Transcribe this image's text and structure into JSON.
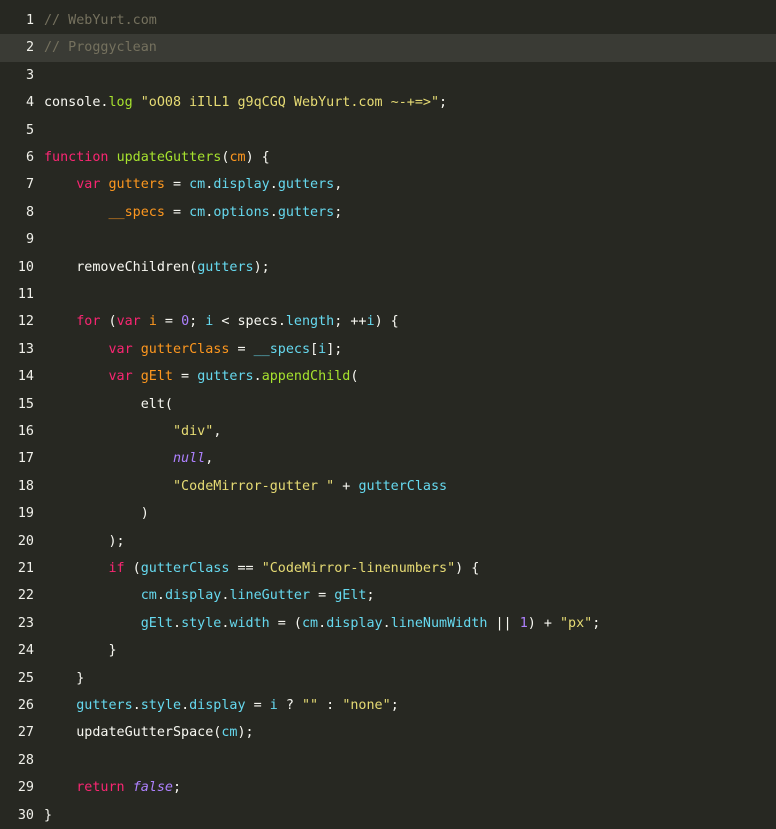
{
  "editor": {
    "active_line": 2,
    "lines": [
      {
        "n": "1",
        "tokens": [
          {
            "t": "// WebYurt.com",
            "c": "comment"
          }
        ]
      },
      {
        "n": "2",
        "tokens": [
          {
            "t": "// Proggyclean",
            "c": "comment"
          }
        ]
      },
      {
        "n": "3",
        "tokens": []
      },
      {
        "n": "4",
        "tokens": [
          {
            "t": "console.",
            "c": "plain"
          },
          {
            "t": "log",
            "c": "prop"
          },
          {
            "t": " ",
            "c": "plain"
          },
          {
            "t": "\"oO08 iIlL1 g9qCGQ WebYurt.com ~-+=>\"",
            "c": "str"
          },
          {
            "t": ";",
            "c": "plain"
          }
        ]
      },
      {
        "n": "5",
        "tokens": []
      },
      {
        "n": "6",
        "tokens": [
          {
            "t": "function",
            "c": "keyword"
          },
          {
            "t": " ",
            "c": "plain"
          },
          {
            "t": "updateGutters",
            "c": "prop"
          },
          {
            "t": "(",
            "c": "plain"
          },
          {
            "t": "cm",
            "c": "def"
          },
          {
            "t": ") {",
            "c": "plain"
          }
        ]
      },
      {
        "n": "7",
        "tokens": [
          {
            "t": "    ",
            "c": "plain"
          },
          {
            "t": "var",
            "c": "keyword"
          },
          {
            "t": " ",
            "c": "plain"
          },
          {
            "t": "gutters",
            "c": "def"
          },
          {
            "t": " = ",
            "c": "plain"
          },
          {
            "t": "cm",
            "c": "var"
          },
          {
            "t": ".",
            "c": "plain"
          },
          {
            "t": "display",
            "c": "var"
          },
          {
            "t": ".",
            "c": "plain"
          },
          {
            "t": "gutters",
            "c": "var"
          },
          {
            "t": ",",
            "c": "plain"
          }
        ]
      },
      {
        "n": "8",
        "tokens": [
          {
            "t": "        ",
            "c": "plain"
          },
          {
            "t": "__specs",
            "c": "def"
          },
          {
            "t": " = ",
            "c": "plain"
          },
          {
            "t": "cm",
            "c": "var"
          },
          {
            "t": ".",
            "c": "plain"
          },
          {
            "t": "options",
            "c": "var"
          },
          {
            "t": ".",
            "c": "plain"
          },
          {
            "t": "gutters",
            "c": "var"
          },
          {
            "t": ";",
            "c": "plain"
          }
        ]
      },
      {
        "n": "9",
        "tokens": []
      },
      {
        "n": "10",
        "tokens": [
          {
            "t": "    removeChildren(",
            "c": "plain"
          },
          {
            "t": "gutters",
            "c": "var"
          },
          {
            "t": ");",
            "c": "plain"
          }
        ]
      },
      {
        "n": "11",
        "tokens": []
      },
      {
        "n": "12",
        "tokens": [
          {
            "t": "    ",
            "c": "plain"
          },
          {
            "t": "for",
            "c": "keyword"
          },
          {
            "t": " (",
            "c": "plain"
          },
          {
            "t": "var",
            "c": "keyword"
          },
          {
            "t": " ",
            "c": "plain"
          },
          {
            "t": "i",
            "c": "def"
          },
          {
            "t": " = ",
            "c": "plain"
          },
          {
            "t": "0",
            "c": "num"
          },
          {
            "t": "; ",
            "c": "plain"
          },
          {
            "t": "i",
            "c": "var"
          },
          {
            "t": " < ",
            "c": "plain"
          },
          {
            "t": "specs",
            "c": "plain"
          },
          {
            "t": ".",
            "c": "plain"
          },
          {
            "t": "length",
            "c": "var"
          },
          {
            "t": "; ++",
            "c": "plain"
          },
          {
            "t": "i",
            "c": "var"
          },
          {
            "t": ") {",
            "c": "plain"
          }
        ]
      },
      {
        "n": "13",
        "tokens": [
          {
            "t": "        ",
            "c": "plain"
          },
          {
            "t": "var",
            "c": "keyword"
          },
          {
            "t": " ",
            "c": "plain"
          },
          {
            "t": "gutterClass",
            "c": "def"
          },
          {
            "t": " = ",
            "c": "plain"
          },
          {
            "t": "__specs",
            "c": "var"
          },
          {
            "t": "[",
            "c": "plain"
          },
          {
            "t": "i",
            "c": "var"
          },
          {
            "t": "];",
            "c": "plain"
          }
        ]
      },
      {
        "n": "14",
        "tokens": [
          {
            "t": "        ",
            "c": "plain"
          },
          {
            "t": "var",
            "c": "keyword"
          },
          {
            "t": " ",
            "c": "plain"
          },
          {
            "t": "gElt",
            "c": "def"
          },
          {
            "t": " = ",
            "c": "plain"
          },
          {
            "t": "gutters",
            "c": "var"
          },
          {
            "t": ".",
            "c": "plain"
          },
          {
            "t": "appendChild",
            "c": "prop"
          },
          {
            "t": "(",
            "c": "plain"
          }
        ]
      },
      {
        "n": "15",
        "tokens": [
          {
            "t": "            elt(",
            "c": "plain"
          }
        ]
      },
      {
        "n": "16",
        "tokens": [
          {
            "t": "                ",
            "c": "plain"
          },
          {
            "t": "\"div\"",
            "c": "str"
          },
          {
            "t": ",",
            "c": "plain"
          }
        ]
      },
      {
        "n": "17",
        "tokens": [
          {
            "t": "                ",
            "c": "plain"
          },
          {
            "t": "null",
            "c": "atom"
          },
          {
            "t": ",",
            "c": "plain"
          }
        ]
      },
      {
        "n": "18",
        "tokens": [
          {
            "t": "                ",
            "c": "plain"
          },
          {
            "t": "\"CodeMirror-gutter \"",
            "c": "str"
          },
          {
            "t": " + ",
            "c": "plain"
          },
          {
            "t": "gutterClass",
            "c": "var"
          }
        ]
      },
      {
        "n": "19",
        "tokens": [
          {
            "t": "            )",
            "c": "plain"
          }
        ]
      },
      {
        "n": "20",
        "tokens": [
          {
            "t": "        );",
            "c": "plain"
          }
        ]
      },
      {
        "n": "21",
        "tokens": [
          {
            "t": "        ",
            "c": "plain"
          },
          {
            "t": "if",
            "c": "keyword"
          },
          {
            "t": " (",
            "c": "plain"
          },
          {
            "t": "gutterClass",
            "c": "var"
          },
          {
            "t": " == ",
            "c": "plain"
          },
          {
            "t": "\"CodeMirror-linenumbers\"",
            "c": "str"
          },
          {
            "t": ") {",
            "c": "plain"
          }
        ]
      },
      {
        "n": "22",
        "tokens": [
          {
            "t": "            ",
            "c": "plain"
          },
          {
            "t": "cm",
            "c": "var"
          },
          {
            "t": ".",
            "c": "plain"
          },
          {
            "t": "display",
            "c": "var"
          },
          {
            "t": ".",
            "c": "plain"
          },
          {
            "t": "lineGutter",
            "c": "var"
          },
          {
            "t": " = ",
            "c": "plain"
          },
          {
            "t": "gElt",
            "c": "var"
          },
          {
            "t": ";",
            "c": "plain"
          }
        ]
      },
      {
        "n": "23",
        "tokens": [
          {
            "t": "            ",
            "c": "plain"
          },
          {
            "t": "gElt",
            "c": "var"
          },
          {
            "t": ".",
            "c": "plain"
          },
          {
            "t": "style",
            "c": "var"
          },
          {
            "t": ".",
            "c": "plain"
          },
          {
            "t": "width",
            "c": "var"
          },
          {
            "t": " = (",
            "c": "plain"
          },
          {
            "t": "cm",
            "c": "var"
          },
          {
            "t": ".",
            "c": "plain"
          },
          {
            "t": "display",
            "c": "var"
          },
          {
            "t": ".",
            "c": "plain"
          },
          {
            "t": "lineNumWidth",
            "c": "var"
          },
          {
            "t": " || ",
            "c": "plain"
          },
          {
            "t": "1",
            "c": "num"
          },
          {
            "t": ") + ",
            "c": "plain"
          },
          {
            "t": "\"px\"",
            "c": "str"
          },
          {
            "t": ";",
            "c": "plain"
          }
        ]
      },
      {
        "n": "24",
        "tokens": [
          {
            "t": "        }",
            "c": "plain"
          }
        ]
      },
      {
        "n": "25",
        "tokens": [
          {
            "t": "    }",
            "c": "plain"
          }
        ]
      },
      {
        "n": "26",
        "tokens": [
          {
            "t": "    ",
            "c": "plain"
          },
          {
            "t": "gutters",
            "c": "var"
          },
          {
            "t": ".",
            "c": "plain"
          },
          {
            "t": "style",
            "c": "var"
          },
          {
            "t": ".",
            "c": "plain"
          },
          {
            "t": "display",
            "c": "var"
          },
          {
            "t": " = ",
            "c": "plain"
          },
          {
            "t": "i",
            "c": "var"
          },
          {
            "t": " ? ",
            "c": "plain"
          },
          {
            "t": "\"\"",
            "c": "str"
          },
          {
            "t": " : ",
            "c": "plain"
          },
          {
            "t": "\"none\"",
            "c": "str"
          },
          {
            "t": ";",
            "c": "plain"
          }
        ]
      },
      {
        "n": "27",
        "tokens": [
          {
            "t": "    updateGutterSpace(",
            "c": "plain"
          },
          {
            "t": "cm",
            "c": "var"
          },
          {
            "t": ");",
            "c": "plain"
          }
        ]
      },
      {
        "n": "28",
        "tokens": []
      },
      {
        "n": "29",
        "tokens": [
          {
            "t": "    ",
            "c": "plain"
          },
          {
            "t": "return",
            "c": "keyword"
          },
          {
            "t": " ",
            "c": "plain"
          },
          {
            "t": "false",
            "c": "atom"
          },
          {
            "t": ";",
            "c": "plain"
          }
        ]
      },
      {
        "n": "30",
        "tokens": [
          {
            "t": "}",
            "c": "plain"
          }
        ]
      }
    ]
  }
}
